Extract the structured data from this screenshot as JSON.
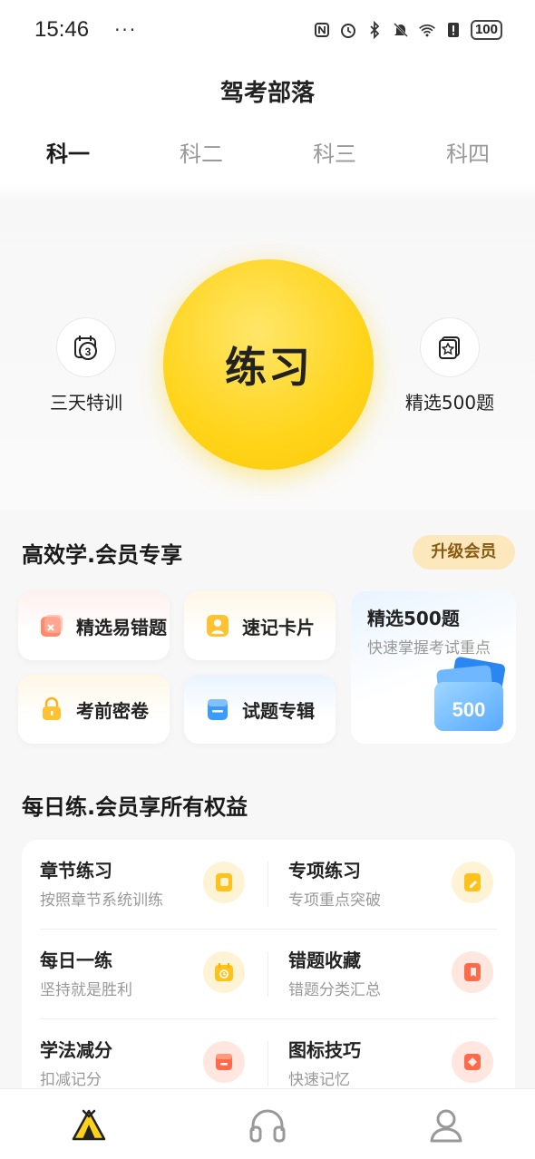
{
  "status_bar": {
    "time": "15:46",
    "dots": "···",
    "battery": "100"
  },
  "header": {
    "title": "驾考部落",
    "tabs": [
      {
        "label": "科一",
        "active": true
      },
      {
        "label": "科二",
        "active": false
      },
      {
        "label": "科三",
        "active": false
      },
      {
        "label": "科四",
        "active": false
      }
    ]
  },
  "hero": {
    "main_button": "练习",
    "left_item": {
      "label": "三天特训",
      "icon": "calendar-3-icon"
    },
    "right_item": {
      "label": "精选500题",
      "icon": "star-cards-icon"
    }
  },
  "member_section": {
    "title": "高效学.会员专享",
    "upgrade_label": "升级会员",
    "cards": [
      {
        "label": "精选易错题",
        "icon": "wrong-question-icon",
        "color": "#ff7a5c"
      },
      {
        "label": "速记卡片",
        "icon": "flash-card-icon",
        "color": "#ffb020"
      },
      {
        "label": "考前密卷",
        "icon": "lock-paper-icon",
        "color": "#ffb020"
      },
      {
        "label": "试题专辑",
        "icon": "album-icon",
        "color": "#3a9bff"
      }
    ],
    "feature_card": {
      "title": "精选500题",
      "subtitle": "快速掌握考试重点",
      "badge": "500"
    }
  },
  "daily_section": {
    "title": "每日练.会员享所有权益",
    "items": [
      {
        "title": "章节练习",
        "subtitle": "按照章节系统训练",
        "icon": "chapter-book-icon",
        "color": "#ffc21a"
      },
      {
        "title": "专项练习",
        "subtitle": "专项重点突破",
        "icon": "special-edit-icon",
        "color": "#ffc21a"
      },
      {
        "title": "每日一练",
        "subtitle": "坚持就是胜利",
        "icon": "daily-calendar-icon",
        "color": "#ffc21a"
      },
      {
        "title": "错题收藏",
        "subtitle": "错题分类汇总",
        "icon": "wrong-collect-icon",
        "color": "#ff6a4a"
      },
      {
        "title": "学法减分",
        "subtitle": "扣减记分",
        "icon": "reduce-points-icon",
        "color": "#ff6a4a"
      },
      {
        "title": "图标技巧",
        "subtitle": "快速记忆",
        "icon": "sign-tips-icon",
        "color": "#ff6a4a"
      }
    ]
  },
  "bottom_nav": {
    "items": [
      {
        "icon": "home-tent-icon",
        "active": true
      },
      {
        "icon": "headphones-icon",
        "active": false
      },
      {
        "icon": "profile-icon",
        "active": false
      }
    ]
  },
  "colors": {
    "accent_yellow": "#ffd41a",
    "text_dark": "#1f1f1f",
    "text_muted": "#999999",
    "upgrade_bg": "#fde8bd",
    "upgrade_text": "#8a5a12"
  }
}
